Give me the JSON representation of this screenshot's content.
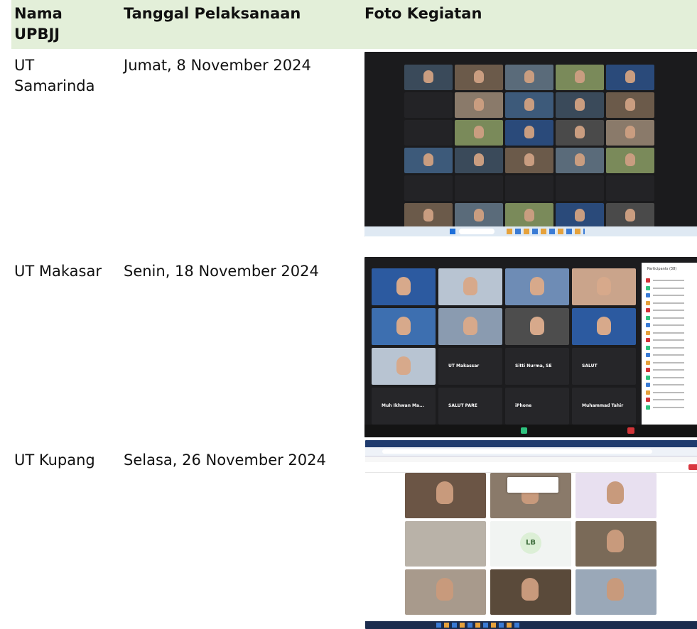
{
  "table": {
    "headers": {
      "col1": "Nama UPBJJ",
      "col2": "Tanggal Pelaksanaan",
      "col3": "Foto Kegiatan"
    },
    "rows": [
      {
        "upbjj": "UT Samarinda",
        "date": "Jumat, 8 November 2024",
        "photo_icon": "zoom-gallery-screenshot"
      },
      {
        "upbjj": "UT Makasar",
        "date": "Senin, 18 November 2024",
        "photo_icon": "zoom-workplace-screenshot"
      },
      {
        "upbjj": "UT Kupang",
        "date": "Selasa, 26 November 2024",
        "photo_icon": "browser-meeting-screenshot"
      }
    ]
  },
  "shot2": {
    "tiles": [
      "UT Makassar",
      "Sitti Nurma, SE",
      "SALUT",
      "Muh Ikhwan Ma...",
      "SALUT PARE",
      "iPhone",
      "Muhammad Tahir"
    ],
    "panel_title": "Participants (38)"
  },
  "shot3": {
    "avatar_initials": "LB"
  },
  "colors": {
    "header_bg": "#e3efd9"
  }
}
